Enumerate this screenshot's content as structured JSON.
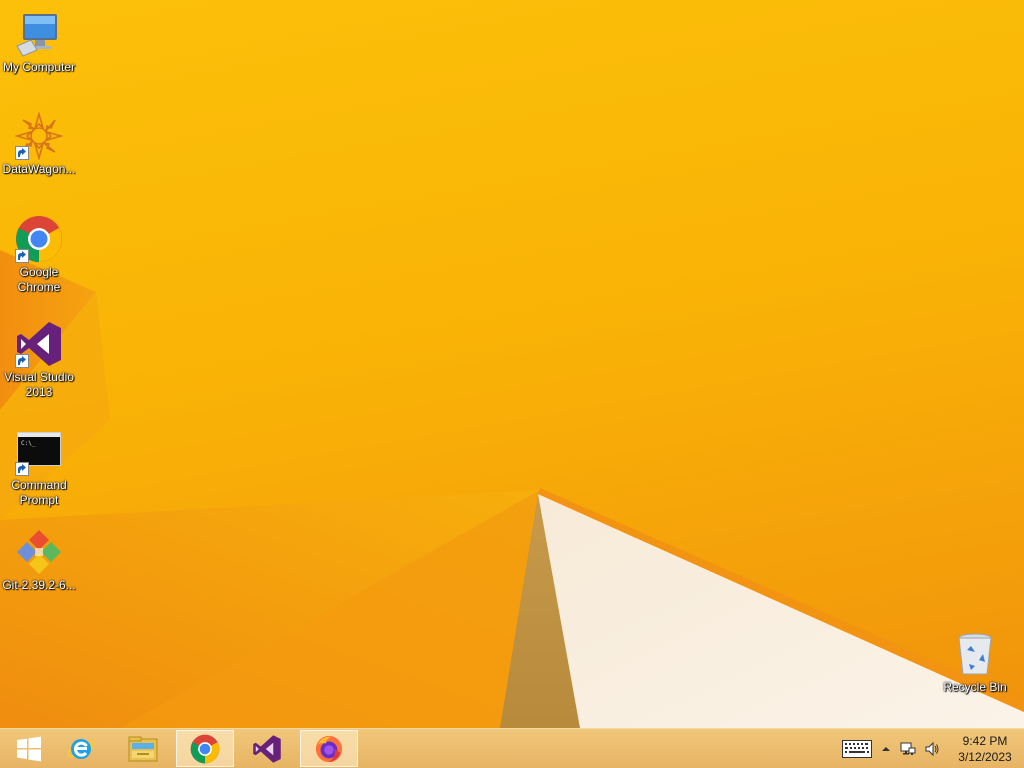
{
  "desktop": {
    "icons": [
      {
        "label": "My Computer",
        "icon": "computer-icon"
      },
      {
        "label": "DataWagon...",
        "icon": "datawagon-icon"
      },
      {
        "label": "Google Chrome",
        "icon": "chrome-icon"
      },
      {
        "label": "Visual Studio 2013",
        "icon": "visual-studio-icon"
      },
      {
        "label": "Command Prompt",
        "icon": "command-prompt-icon"
      },
      {
        "label": "Git-2.39.2-6...",
        "icon": "git-installer-icon"
      },
      {
        "label": "Recycle Bin",
        "icon": "recycle-bin-icon"
      }
    ]
  },
  "taskbar": {
    "buttons": [
      {
        "name": "start",
        "icon": "windows-logo-icon"
      },
      {
        "name": "internet-explorer",
        "icon": "internet-explorer-icon"
      },
      {
        "name": "file-explorer",
        "icon": "file-explorer-icon"
      },
      {
        "name": "chrome",
        "icon": "chrome-icon",
        "active": true
      },
      {
        "name": "visual-studio",
        "icon": "visual-studio-icon"
      },
      {
        "name": "firefox",
        "icon": "firefox-icon",
        "active": true
      }
    ],
    "tray": {
      "icons": [
        "touch-keyboard-icon",
        "show-hidden-icons-icon",
        "network-icon",
        "volume-icon"
      ],
      "time": "9:42 PM",
      "date": "3/12/2023"
    }
  },
  "colors": {
    "wallpaper": "#f9b305",
    "taskbar": "#ecbe6e"
  }
}
